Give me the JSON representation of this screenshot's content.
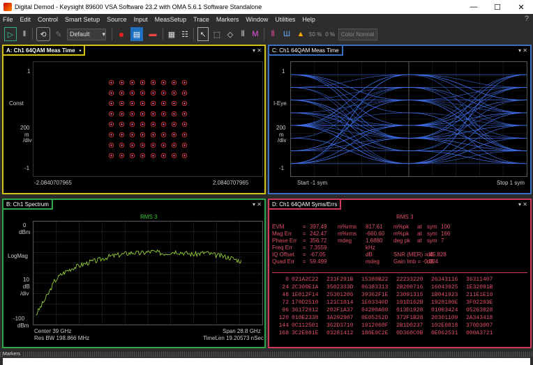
{
  "window": {
    "title": "Digital Demod - Keysight 89600 VSA Software 23.2 with OMA 5.6.1 Software Standalone",
    "min": "—",
    "max": "☐",
    "close": "✕"
  },
  "menu": [
    "File",
    "Edit",
    "Control",
    "Smart Setup",
    "Source",
    "Input",
    "MeasSetup",
    "Trace",
    "Markers",
    "Window",
    "Utilities",
    "Help"
  ],
  "menu_help": "?",
  "toolbar": {
    "preset": "Default",
    "pct1": "50 %",
    "pct2": "0 %",
    "color_mode": "Color Normal"
  },
  "paneA": {
    "title": "A: Ch1 64QAM Meas Time",
    "top": "1",
    "mid": "Const",
    "scale1": "200",
    "scale2": "m",
    "scale3": "/div",
    "bottom": "-1",
    "xleft": "-2.0840707965",
    "xright": "2.0840707965"
  },
  "paneB": {
    "title": "B: Ch1 Spectrum",
    "header": "RMS 3",
    "top": "0",
    "unit_top": "dBm",
    "mid": "LogMag",
    "scale1": "10",
    "scale2": "dB",
    "scale3": "/div",
    "bottom": "-100",
    "unit_bottom": "dBm",
    "center": "Center 39 GHz",
    "span": "Span 28.8 GHz",
    "rbw": "Res BW 198.866 MHz",
    "timelen": "TimeLen 19.20573 nSec"
  },
  "paneC": {
    "title": "C: Ch1 64QAM Meas Time",
    "top": "1",
    "mid": "I-Eye",
    "scale1": "200",
    "scale2": "m",
    "scale3": "/div",
    "bottom": "-1",
    "start": "Start -1  sym",
    "stop": "Stop 1  sym"
  },
  "paneD": {
    "title": "D: Ch1 64QAM Syms/Errs",
    "header": "RMS 3",
    "metrics": [
      [
        "EVM",
        "=",
        "397.49",
        "m%rms",
        "817.61",
        "m%pk",
        "at",
        "sym",
        "100"
      ],
      [
        "Mag Err",
        "=",
        "242.47",
        "m%rms",
        "-660.60",
        "m%pk",
        "at",
        "sym",
        "166"
      ],
      [
        "Phase Err",
        "=",
        "356.72",
        "mdeg",
        "1.6880",
        "deg pk",
        "at",
        "sym",
        "7"
      ],
      [
        "Freq Err",
        "=",
        "7.3559",
        "",
        "kHz",
        "",
        "",
        "",
        ""
      ],
      [
        "IQ Offset",
        "=",
        "-67.05",
        "",
        "dB",
        "SNR (MER) = 45.828",
        "",
        "dB",
        ""
      ],
      [
        "Quad Err",
        "=",
        "59.499",
        "",
        "mdeg",
        "Gain Imb = -0.004",
        "",
        "dB",
        ""
      ]
    ],
    "syms": [
      [
        "0",
        "021A2C22",
        "231F291B",
        "15380B22",
        "22233220",
        "26343116",
        "36311407"
      ],
      [
        "24",
        "2C300E1A",
        "3502333D",
        "06383313",
        "2B200716",
        "16043925",
        "1E32091B"
      ],
      [
        "48",
        "1E012F14",
        "25301206",
        "39362F1E",
        "23091315",
        "1B041923",
        "211E1E10"
      ],
      [
        "72",
        "170D2510",
        "121C1014",
        "1E03340D",
        "101D162B",
        "1928180E",
        "3F02293E"
      ],
      [
        "96",
        "36172912",
        "202F1A37",
        "04290A08",
        "013D1928",
        "01063424",
        "05263828"
      ],
      [
        "120",
        "010E2338",
        "3A292907",
        "0E05252D",
        "372F1B28",
        "20301109",
        "2A343418"
      ],
      [
        "144",
        "0C112501",
        "362D3710",
        "1912060F",
        "2B1D0237",
        "102E0818",
        "370D3007"
      ],
      [
        "168",
        "3C2E081E",
        "03281412",
        "180E0C2E",
        "0D360C0B",
        "0E062531",
        "000A3721"
      ]
    ]
  },
  "markers": {
    "title": "Markers"
  },
  "chart_data": [
    {
      "type": "scatter",
      "title": "A: Ch1 64QAM Meas Time",
      "ylabel": "Const",
      "xlim": [
        -2.0840707965,
        2.0840707965
      ],
      "ylim": [
        -1,
        1
      ],
      "grid": "8x8",
      "levels_x": [
        -7,
        -5,
        -3,
        -1,
        1,
        3,
        5,
        7
      ],
      "levels_y": [
        -7,
        -5,
        -3,
        -1,
        1,
        3,
        5,
        7
      ]
    },
    {
      "type": "line",
      "title": "B: Ch1 Spectrum",
      "ylabel": "LogMag",
      "ylim": [
        -100,
        0
      ],
      "x_unit": "GHz",
      "center": 39,
      "span": 28.8,
      "series": [
        {
          "values": [
            -90,
            -80,
            -70,
            -58,
            -52,
            -48,
            -45,
            -43,
            -41,
            -39,
            -38,
            -36,
            -34,
            -33,
            -32,
            -31,
            -30,
            -31,
            -30,
            -29,
            -30,
            -31,
            -30,
            -29,
            -30,
            -31,
            -32,
            -31,
            -30,
            -32,
            -33,
            -34,
            -35,
            -37,
            -39
          ]
        }
      ]
    },
    {
      "type": "line",
      "title": "C: Ch1 64QAM Meas Time",
      "ylabel": "I-Eye",
      "xlim": [
        -1,
        1
      ],
      "ylim": [
        -1,
        1
      ]
    }
  ]
}
